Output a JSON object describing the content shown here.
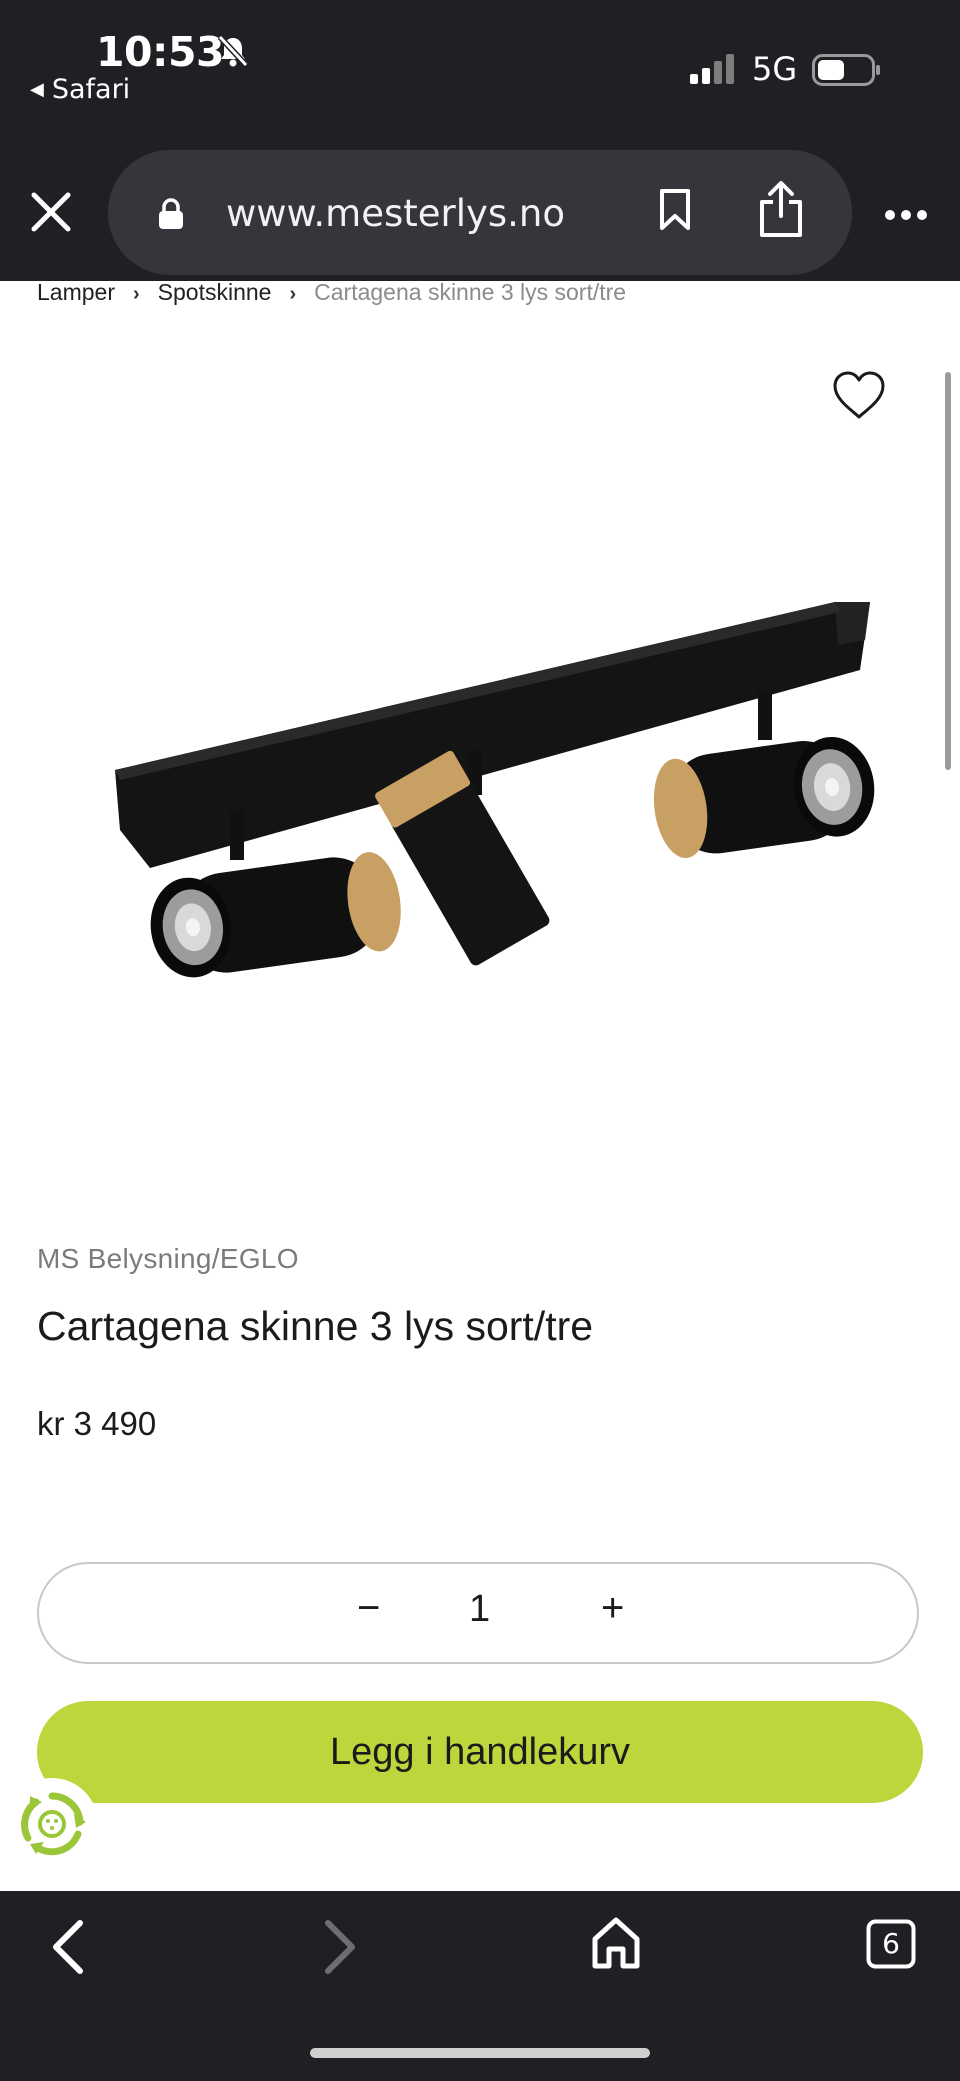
{
  "status_bar": {
    "time": "10:53",
    "back_app": "Safari",
    "network": "5G"
  },
  "browser": {
    "url": "www.mesterlys.no",
    "tabs_count": "6"
  },
  "breadcrumb": {
    "items": [
      "Lamper",
      "Spotskinne"
    ],
    "current": "Cartagena skinne 3 lys sort/tre"
  },
  "product": {
    "brand": "MS Belysning/EGLO",
    "title": "Cartagena skinne 3 lys sort/tre",
    "price": "kr 3 490",
    "quantity": "1",
    "qty_minus": "−",
    "qty_plus": "+",
    "add_to_cart": "Legg i handlekurv"
  },
  "colors": {
    "chrome_bg": "#1f2023",
    "cart_button": "#bcd63c",
    "eco_badge": "#9ac63a"
  },
  "icons": [
    "bell-slash-icon",
    "signal-icon",
    "battery-icon",
    "close-icon",
    "lock-icon",
    "bookmark-icon",
    "share-icon",
    "more-icon",
    "heart-icon",
    "recycle-icon",
    "back-icon",
    "forward-icon",
    "home-icon",
    "tabs-icon"
  ]
}
